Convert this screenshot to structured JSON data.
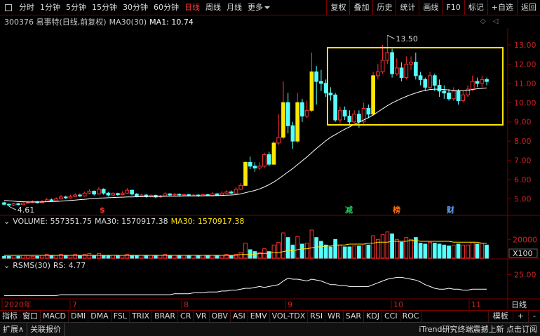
{
  "toolbar": {
    "timeframes": [
      {
        "label": "分时",
        "active": false
      },
      {
        "label": "1分钟",
        "active": false
      },
      {
        "label": "5分钟",
        "active": false
      },
      {
        "label": "15分钟",
        "active": false
      },
      {
        "label": "30分钟",
        "active": false
      },
      {
        "label": "60分钟",
        "active": false
      },
      {
        "label": "日线",
        "active": true
      },
      {
        "label": "周线",
        "active": false
      },
      {
        "label": "月线",
        "active": false
      }
    ],
    "more_label": "更多",
    "right_buttons": [
      "复权",
      "叠加",
      "历史",
      "统计",
      "画线",
      "F10",
      "标记",
      "+自选",
      "返回"
    ]
  },
  "stock": {
    "title": "300376 易事特(日线,前复权)",
    "ma_label": "MA30(30)",
    "ma1_text": "MA1: 10.74"
  },
  "price_panel": {
    "y_ticks": [
      "13.00",
      "12.00",
      "11.00",
      "10.00",
      "9.00",
      "8.00",
      "7.00",
      "6.00",
      "5.00"
    ],
    "high_label": "13.50",
    "low_label": "4.61",
    "markers": [
      {
        "text": "$",
        "color": "#ff3030"
      },
      {
        "text": "减",
        "color": "#22c55e"
      },
      {
        "text": "榜",
        "color": "#f97316"
      },
      {
        "text": "财",
        "color": "#60a5fa"
      }
    ]
  },
  "volume_panel": {
    "label": "VOLUME: 557351.75",
    "ma30_white": "MA30: 1570917.38",
    "ma30_yellow": "MA30: 1570917.38",
    "y_tick": "20000",
    "unit": "X100"
  },
  "rsms_panel": {
    "label": "RSMS(30)",
    "rs_text": "RS: 4.77",
    "y_tick": "25.00"
  },
  "x_axis": {
    "labels": [
      "2020年",
      "7",
      "8",
      "9",
      "10",
      "11"
    ],
    "period_label": "日线"
  },
  "tabs": {
    "items": [
      "指标",
      "窗口",
      "MACD",
      "DMI",
      "DMA",
      "FSL",
      "TRIX",
      "BRAR",
      "CR",
      "VR",
      "OBV",
      "ASI",
      "EMV",
      "VOL-TDX",
      "RSI",
      "WR",
      "SAR",
      "KDJ",
      "CCI",
      "ROC"
    ],
    "right": [
      "模板",
      "+",
      "-"
    ]
  },
  "status": {
    "expand": "扩展∧",
    "report": "关联报价",
    "news": "iTrend研究终端震撼上新 点击订阅"
  },
  "chart_data": {
    "type": "candlestick",
    "ylim": [
      4.4,
      13.8
    ],
    "series": [
      {
        "name": "MA30",
        "color": "#ffffff"
      }
    ],
    "candles": [
      [
        4.8,
        4.72,
        4.85,
        4.66
      ],
      [
        4.72,
        4.68,
        4.76,
        4.61
      ],
      [
        4.68,
        4.75,
        4.8,
        4.64
      ],
      [
        4.75,
        4.7,
        4.79,
        4.66
      ],
      [
        4.7,
        4.78,
        4.84,
        4.68
      ],
      [
        4.78,
        4.82,
        4.9,
        4.74
      ],
      [
        4.82,
        4.85,
        4.92,
        4.78
      ],
      [
        4.85,
        4.8,
        4.89,
        4.76
      ],
      [
        4.8,
        4.86,
        4.94,
        4.78
      ],
      [
        4.86,
        4.95,
        5.05,
        4.84
      ],
      [
        4.95,
        4.9,
        5.02,
        4.86
      ],
      [
        4.9,
        5.0,
        5.08,
        4.88
      ],
      [
        5.0,
        5.1,
        5.2,
        4.96
      ],
      [
        5.1,
        5.05,
        5.16,
        5.0
      ],
      [
        5.05,
        5.12,
        5.22,
        5.02
      ],
      [
        5.12,
        5.2,
        5.3,
        5.08
      ],
      [
        5.2,
        5.15,
        5.28,
        5.1
      ],
      [
        5.15,
        5.3,
        5.38,
        5.12
      ],
      [
        5.3,
        5.4,
        5.5,
        5.24
      ],
      [
        5.4,
        5.25,
        5.44,
        5.18
      ],
      [
        5.25,
        5.5,
        5.62,
        5.22
      ],
      [
        5.5,
        5.3,
        5.55,
        5.22
      ],
      [
        5.3,
        5.2,
        5.36,
        5.12
      ],
      [
        5.2,
        5.28,
        5.34,
        5.14
      ],
      [
        5.28,
        5.22,
        5.32,
        5.16
      ],
      [
        5.22,
        5.3,
        5.4,
        5.18
      ],
      [
        5.3,
        5.45,
        5.56,
        5.26
      ],
      [
        5.45,
        5.25,
        5.48,
        5.18
      ],
      [
        5.25,
        5.15,
        5.3,
        5.08
      ],
      [
        5.15,
        5.2,
        5.26,
        5.1
      ],
      [
        5.2,
        5.12,
        5.25,
        5.06
      ],
      [
        5.12,
        5.18,
        5.24,
        5.08
      ],
      [
        5.18,
        5.1,
        5.22,
        5.04
      ],
      [
        5.1,
        5.16,
        5.2,
        5.06
      ],
      [
        5.16,
        5.26,
        5.34,
        5.12
      ],
      [
        5.26,
        5.2,
        5.3,
        5.14
      ],
      [
        5.2,
        5.24,
        5.3,
        5.16
      ],
      [
        5.24,
        5.2,
        5.28,
        5.14
      ],
      [
        5.2,
        5.22,
        5.28,
        5.16
      ],
      [
        5.22,
        5.18,
        5.26,
        5.12
      ],
      [
        5.18,
        5.2,
        5.26,
        5.14
      ],
      [
        5.2,
        5.16,
        5.24,
        5.1
      ],
      [
        5.16,
        5.22,
        5.28,
        5.12
      ],
      [
        5.22,
        5.18,
        5.26,
        5.14
      ],
      [
        5.18,
        5.26,
        5.34,
        5.14
      ],
      [
        5.26,
        5.2,
        5.32,
        5.16
      ],
      [
        5.2,
        5.3,
        5.4,
        5.18
      ],
      [
        5.3,
        5.36,
        5.45,
        5.26
      ],
      [
        5.36,
        5.3,
        5.44,
        5.24
      ],
      [
        5.3,
        5.5,
        5.62,
        5.28
      ],
      [
        5.5,
        5.7,
        5.82,
        5.46
      ],
      [
        5.7,
        6.9,
        6.95,
        5.66
      ],
      [
        6.9,
        6.7,
        7.2,
        6.55
      ],
      [
        6.7,
        6.6,
        6.9,
        6.4
      ],
      [
        6.6,
        6.7,
        6.9,
        6.5
      ],
      [
        6.7,
        7.3,
        7.4,
        6.6
      ],
      [
        7.3,
        6.8,
        7.45,
        6.7
      ],
      [
        6.8,
        7.9,
        8.0,
        6.75
      ],
      [
        7.9,
        8.2,
        9.4,
        7.8
      ],
      [
        8.2,
        10.0,
        11.1,
        8.1
      ],
      [
        10.0,
        8.8,
        10.5,
        8.4
      ],
      [
        8.8,
        8.0,
        9.0,
        7.6
      ],
      [
        8.0,
        10.0,
        10.5,
        7.9
      ],
      [
        10.0,
        9.3,
        10.2,
        9.0
      ],
      [
        9.3,
        9.6,
        10.1,
        9.2
      ],
      [
        9.6,
        11.6,
        12.6,
        9.5
      ],
      [
        11.6,
        11.1,
        11.9,
        9.9
      ],
      [
        11.1,
        11.0,
        11.7,
        10.6
      ],
      [
        11.0,
        10.5,
        11.2,
        10.3
      ],
      [
        10.5,
        10.4,
        10.8,
        10.1
      ],
      [
        10.4,
        9.1,
        10.5,
        9.0
      ],
      [
        9.1,
        9.6,
        9.8,
        8.9
      ],
      [
        9.6,
        9.3,
        9.8,
        9.1
      ],
      [
        9.3,
        9.0,
        9.6,
        8.8
      ],
      [
        9.0,
        9.4,
        9.6,
        8.9
      ],
      [
        9.4,
        9.0,
        9.6,
        8.7
      ],
      [
        9.0,
        9.7,
        10.0,
        8.9
      ],
      [
        9.7,
        9.4,
        9.9,
        9.2
      ],
      [
        9.4,
        11.4,
        11.6,
        9.3
      ],
      [
        11.4,
        11.6,
        12.0,
        11.2
      ],
      [
        11.6,
        12.2,
        13.0,
        11.5
      ],
      [
        12.2,
        12.6,
        13.5,
        12.0
      ],
      [
        12.6,
        11.5,
        12.8,
        11.3
      ],
      [
        11.5,
        11.8,
        12.3,
        11.4
      ],
      [
        11.8,
        11.3,
        12.1,
        11.1
      ],
      [
        11.3,
        12.0,
        12.4,
        11.2
      ],
      [
        12.0,
        12.1,
        12.4,
        11.7
      ],
      [
        12.1,
        11.4,
        12.6,
        11.2
      ],
      [
        11.4,
        11.2,
        11.6,
        10.9
      ],
      [
        11.2,
        10.8,
        11.3,
        10.6
      ],
      [
        10.8,
        11.4,
        11.6,
        10.7
      ],
      [
        11.4,
        10.9,
        11.5,
        10.6
      ],
      [
        10.9,
        10.6,
        11.2,
        10.3
      ],
      [
        10.6,
        10.5,
        10.9,
        10.2
      ],
      [
        10.5,
        10.2,
        10.7,
        10.1
      ],
      [
        10.2,
        10.6,
        10.8,
        10.1
      ],
      [
        10.6,
        10.1,
        10.7,
        9.9
      ],
      [
        10.1,
        10.4,
        10.6,
        10.0
      ],
      [
        10.4,
        10.7,
        10.9,
        10.3
      ],
      [
        10.7,
        11.1,
        11.4,
        10.6
      ],
      [
        11.1,
        11.0,
        11.3,
        10.8
      ],
      [
        11.0,
        11.2,
        11.4,
        10.8
      ],
      [
        11.2,
        11.1,
        11.3,
        10.9
      ]
    ],
    "ma": [
      4.92,
      4.9,
      4.88,
      4.86,
      4.85,
      4.84,
      4.84,
      4.84,
      4.84,
      4.85,
      4.86,
      4.87,
      4.88,
      4.9,
      4.92,
      4.94,
      4.96,
      4.98,
      5.0,
      5.02,
      5.04,
      5.05,
      5.06,
      5.07,
      5.08,
      5.09,
      5.1,
      5.1,
      5.11,
      5.11,
      5.12,
      5.12,
      5.13,
      5.13,
      5.14,
      5.14,
      5.14,
      5.14,
      5.15,
      5.15,
      5.15,
      5.15,
      5.16,
      5.16,
      5.16,
      5.17,
      5.18,
      5.19,
      5.2,
      5.22,
      5.26,
      5.32,
      5.38,
      5.44,
      5.52,
      5.62,
      5.74,
      5.88,
      6.04,
      6.22,
      6.4,
      6.58,
      6.78,
      6.98,
      7.18,
      7.4,
      7.62,
      7.82,
      8.02,
      8.2,
      8.34,
      8.48,
      8.62,
      8.74,
      8.86,
      8.98,
      9.1,
      9.22,
      9.36,
      9.52,
      9.68,
      9.84,
      9.98,
      10.1,
      10.22,
      10.32,
      10.42,
      10.5,
      10.58,
      10.63,
      10.68,
      10.7,
      10.7,
      10.68,
      10.66,
      10.64,
      10.62,
      10.62,
      10.64,
      10.68,
      10.72,
      10.74,
      10.76
    ],
    "volume": [
      2,
      2,
      3,
      2,
      3,
      3,
      2,
      2,
      3,
      4,
      3,
      3,
      4,
      3,
      3,
      4,
      3,
      4,
      5,
      3,
      5,
      3,
      3,
      3,
      3,
      3,
      4,
      3,
      3,
      3,
      3,
      3,
      3,
      3,
      4,
      3,
      3,
      3,
      3,
      3,
      3,
      3,
      3,
      3,
      3,
      3,
      3,
      4,
      3,
      4,
      6,
      16,
      9,
      7,
      6,
      10,
      7,
      14,
      17,
      27,
      22,
      14,
      23,
      15,
      16,
      30,
      22,
      18,
      14,
      12,
      20,
      14,
      12,
      12,
      13,
      13,
      15,
      14,
      24,
      20,
      25,
      28,
      26,
      20,
      17,
      22,
      20,
      22,
      16,
      15,
      17,
      16,
      15,
      14,
      13,
      14,
      15,
      14,
      14,
      17,
      15,
      16,
      14
    ],
    "volume_ma": [
      3,
      3,
      3,
      3,
      3,
      3,
      3,
      3,
      3,
      3,
      3,
      3,
      3,
      3,
      3,
      3,
      3,
      3,
      3,
      3,
      3,
      3,
      3,
      3,
      3,
      3,
      3,
      3,
      3,
      3,
      3,
      3,
      3,
      3,
      3,
      3,
      3,
      3,
      3,
      3,
      3,
      3,
      3,
      3,
      3,
      3,
      3,
      3,
      3,
      3,
      4,
      4,
      4,
      4,
      5,
      5,
      5,
      6,
      6,
      7,
      8,
      8,
      9,
      10,
      10,
      11,
      12,
      12,
      13,
      13,
      14,
      14,
      14,
      15,
      15,
      15,
      15,
      16,
      16,
      17,
      17,
      17,
      18,
      18,
      18,
      18,
      19,
      19,
      18,
      18,
      18,
      18,
      18,
      18,
      18,
      17,
      17,
      17,
      17,
      17,
      17,
      16,
      16
    ],
    "rsms": [
      2,
      2,
      2,
      2,
      2,
      2,
      2,
      2,
      2,
      2,
      2,
      2,
      3,
      3,
      3,
      3,
      3,
      3,
      3,
      3,
      3,
      3,
      3,
      3,
      3,
      3,
      3,
      3,
      3,
      3,
      3,
      3,
      3,
      3,
      3,
      3,
      4,
      4,
      4,
      4,
      5,
      5,
      5,
      6,
      6,
      6,
      7,
      7,
      8,
      8,
      9,
      10,
      10,
      11,
      12,
      11,
      12,
      13,
      14,
      18,
      21,
      20,
      20,
      19,
      18,
      20,
      19,
      18,
      16,
      14,
      14,
      13,
      13,
      12,
      12,
      12,
      12,
      12,
      14,
      16,
      18,
      20,
      21,
      22,
      22,
      21,
      20,
      19,
      17,
      14,
      12,
      10,
      9,
      9,
      10,
      9,
      9,
      8,
      8,
      9,
      9,
      9,
      9
    ]
  }
}
